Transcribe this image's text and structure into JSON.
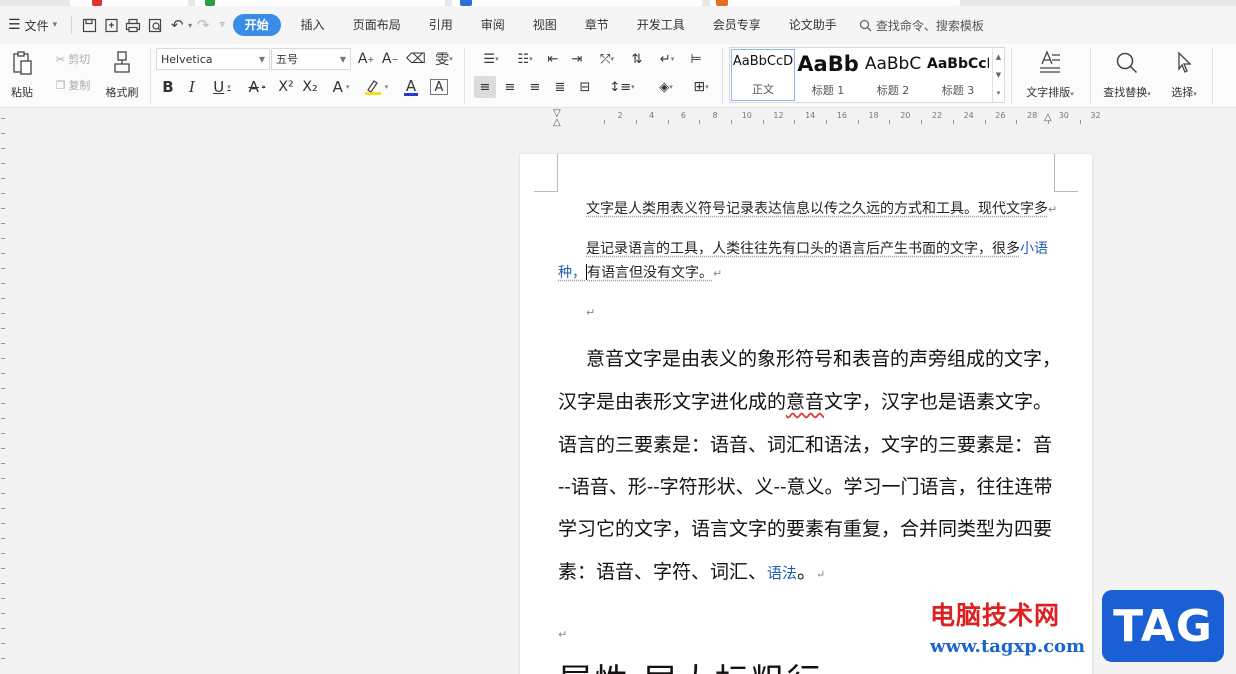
{
  "menubar": {
    "file_label": "文件",
    "tabs": [
      "开始",
      "插入",
      "页面布局",
      "引用",
      "审阅",
      "视图",
      "章节",
      "开发工具",
      "会员专享",
      "论文助手"
    ],
    "active_tab": "开始",
    "search_label": "查找命令、搜索模板"
  },
  "ribbon": {
    "paste": "粘贴",
    "cut": "剪切",
    "copy": "复制",
    "format_painter": "格式刷",
    "font_name": "Helvetica",
    "font_size": "五号",
    "styles": [
      {
        "preview": "AaBbCcD",
        "name": "正文"
      },
      {
        "preview": "AaBb",
        "name": "标题 1"
      },
      {
        "preview": "AaBbC",
        "name": "标题 2"
      },
      {
        "preview": "AaBbCcI",
        "name": "标题 3"
      }
    ],
    "text_layout": "文字排版",
    "find_replace": "查找替换",
    "select": "选择"
  },
  "ruler": {
    "labels": [
      "2",
      "4",
      "6",
      "8",
      "10",
      "12",
      "14",
      "16",
      "18",
      "20",
      "22",
      "24",
      "26",
      "28",
      "30",
      "32"
    ]
  },
  "document": {
    "para1_line1": "文字是人类用表义符号记录表达信息以传之久远的方式和工具。现代文字多",
    "para2_line1_a": "是记录语言的工具，人类往往先有口头的语言后产生书面的文字，很多",
    "para2_line1_b": "小语",
    "para2_line2_a": "种，",
    "para2_line2_b": "有语言但没有文字。",
    "big_lines": [
      "意音文字是由表义的象形符号和表音的声旁组成的文字，",
      "汉字是由表形文字进化成的",
      "意音",
      "文字，汉字也是语素文字。",
      "语言的三要素是：语音、词汇和语法，文字的三要素是：音",
      "--语音、形--字符形状、义--意义。学习一门语言，往往连带",
      "学习它的文字，语言文字的要素有重复，合并同类型为四要",
      "素：语音、字符、词汇、",
      "语法",
      "。"
    ],
    "paragraph_mark": "↵",
    "heading_partial": "属性                       层大标粗行"
  },
  "watermark": {
    "site_name": "电脑技术网",
    "url": "www.tagxp.com",
    "logo": "TAG"
  }
}
